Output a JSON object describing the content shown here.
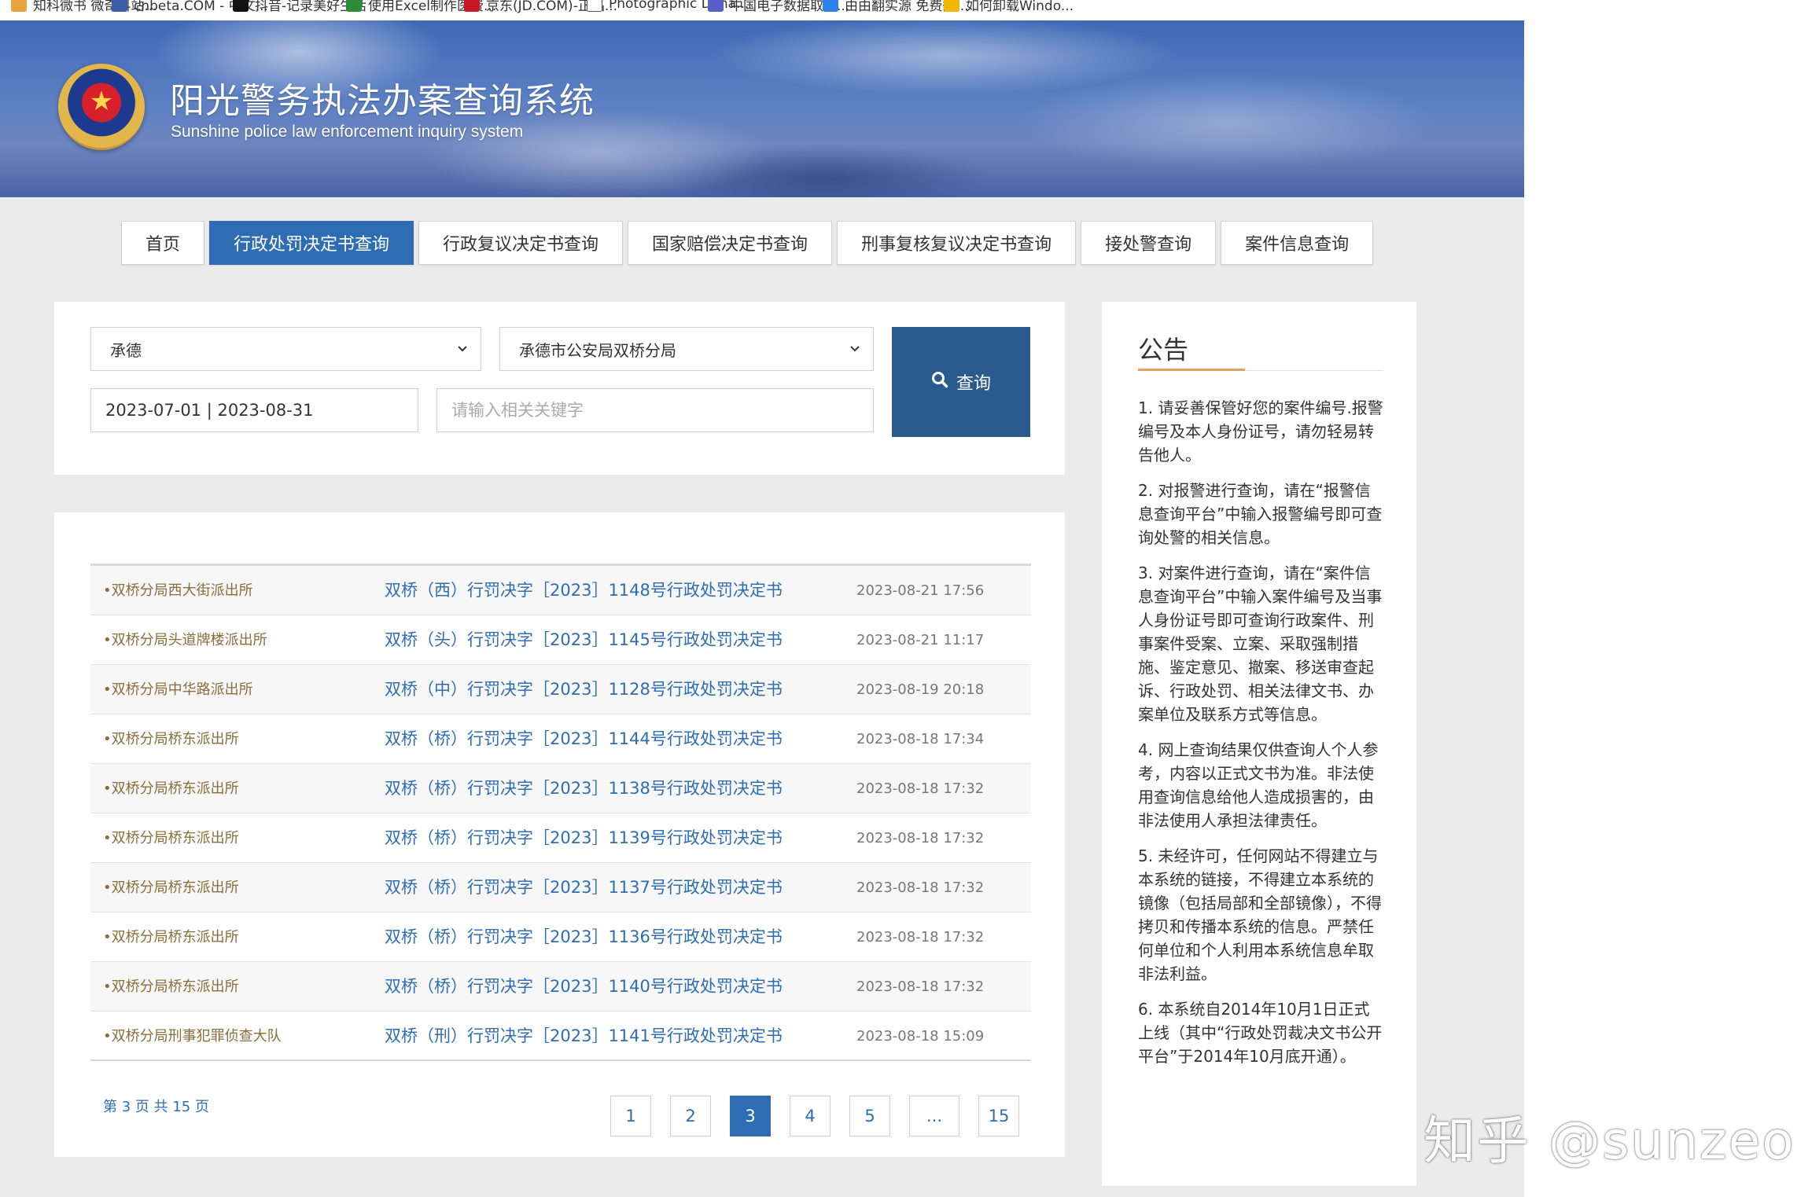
{
  "bookmarks": [
    {
      "label": "知科微书 微奇科站...",
      "color": "#e8a33d"
    },
    {
      "label": "cnbeta.COM - 中文...",
      "color": "#3c5ea8"
    },
    {
      "label": "抖音-记录美好生活",
      "color": "#111111"
    },
    {
      "label": "使用Excel制作医费...",
      "color": "#2e8b3a"
    },
    {
      "label": "京东(JD.COM)-正品...",
      "color": "#c81623"
    },
    {
      "label": "Photographic Dyna...",
      "color": "#ffffff"
    },
    {
      "label": "中国电子数据取证...",
      "color": "#5a5fc8"
    },
    {
      "label": "由由翻实源 免费翻...",
      "color": "#2f80ed"
    },
    {
      "label": "如何卸载Windo...",
      "color": "#f2b705"
    }
  ],
  "header": {
    "title": "阳光警务执法办案查询系统",
    "subtitle": "Sunshine police law enforcement inquiry system"
  },
  "nav": {
    "items": [
      {
        "label": "首页",
        "active": false
      },
      {
        "label": "行政处罚决定书查询",
        "active": true
      },
      {
        "label": "行政复议决定书查询",
        "active": false
      },
      {
        "label": "国家赔偿决定书查询",
        "active": false
      },
      {
        "label": "刑事复核复议决定书查询",
        "active": false
      },
      {
        "label": "接处警查询",
        "active": false
      },
      {
        "label": "案件信息查询",
        "active": false
      }
    ]
  },
  "search": {
    "city_value": "承德",
    "bureau_value": "承德市公安局双桥分局",
    "date_range": "2023-07-01 | 2023-08-31",
    "keyword_placeholder": "请输入相关关键字",
    "button_label": "查询"
  },
  "results": {
    "rows": [
      {
        "dept": "•双桥分局西大街派出所",
        "doc": "双桥（西）行罚决字［2023］1148号行政处罚决定书",
        "time": "2023-08-21 17:56"
      },
      {
        "dept": "•双桥分局头道牌楼派出所",
        "doc": "双桥（头）行罚决字［2023］1145号行政处罚决定书",
        "time": "2023-08-21 11:17"
      },
      {
        "dept": "•双桥分局中华路派出所",
        "doc": "双桥（中）行罚决字［2023］1128号行政处罚决定书",
        "time": "2023-08-19 20:18"
      },
      {
        "dept": "•双桥分局桥东派出所",
        "doc": "双桥（桥）行罚决字［2023］1144号行政处罚决定书",
        "time": "2023-08-18 17:34"
      },
      {
        "dept": "•双桥分局桥东派出所",
        "doc": "双桥（桥）行罚决字［2023］1138号行政处罚决定书",
        "time": "2023-08-18 17:32"
      },
      {
        "dept": "•双桥分局桥东派出所",
        "doc": "双桥（桥）行罚决字［2023］1139号行政处罚决定书",
        "time": "2023-08-18 17:32"
      },
      {
        "dept": "•双桥分局桥东派出所",
        "doc": "双桥（桥）行罚决字［2023］1137号行政处罚决定书",
        "time": "2023-08-18 17:32"
      },
      {
        "dept": "•双桥分局桥东派出所",
        "doc": "双桥（桥）行罚决字［2023］1136号行政处罚决定书",
        "time": "2023-08-18 17:32"
      },
      {
        "dept": "•双桥分局桥东派出所",
        "doc": "双桥（桥）行罚决字［2023］1140号行政处罚决定书",
        "time": "2023-08-18 17:32"
      },
      {
        "dept": "•双桥分局刑事犯罪侦查大队",
        "doc": "双桥（刑）行罚决字［2023］1141号行政处罚决定书",
        "time": "2023-08-18 15:09"
      }
    ],
    "page_info": "第 3 页 共 15 页",
    "pages": [
      {
        "label": "1",
        "active": false
      },
      {
        "label": "2",
        "active": false
      },
      {
        "label": "3",
        "active": true
      },
      {
        "label": "4",
        "active": false
      },
      {
        "label": "5",
        "active": false
      },
      {
        "label": "...",
        "active": false
      },
      {
        "label": "15",
        "active": false
      }
    ]
  },
  "notice": {
    "title": "公告",
    "items": [
      "1. 请妥善保管好您的案件编号.报警编号及本人身份证号，请勿轻易转告他人。",
      "2. 对报警进行查询，请在“报警信息查询平台”中输入报警编号即可查询处警的相关信息。",
      "3. 对案件进行查询，请在“案件信息查询平台”中输入案件编号及当事人身份证号即可查询行政案件、刑事案件受案、立案、采取强制措施、鉴定意见、撤案、移送审查起诉、行政处罚、相关法律文书、办案单位及联系方式等信息。",
      "4. 网上查询结果仅供查询人个人参考，内容以正式文书为准。非法使用查询信息给他人造成损害的，由非法使用人承担法律责任。",
      "5. 未经许可，任何网站不得建立与本系统的链接，不得建立本系统的镜像（包括局部和全部镜像），不得拷贝和传播本系统的信息。严禁任何单位和个人利用本系统信息牟取非法利益。",
      "6. 本系统自2014年10月1日正式上线（其中“行政处罚裁决文书公开平台”于2014年10月底开通）。"
    ]
  },
  "watermark": "知乎 @sunzeo",
  "colors": {
    "accent": "#2e6db4",
    "search_button": "#2b5a8e",
    "dept_text": "#8a6d3b",
    "notice_rule": "#e6a05a"
  }
}
